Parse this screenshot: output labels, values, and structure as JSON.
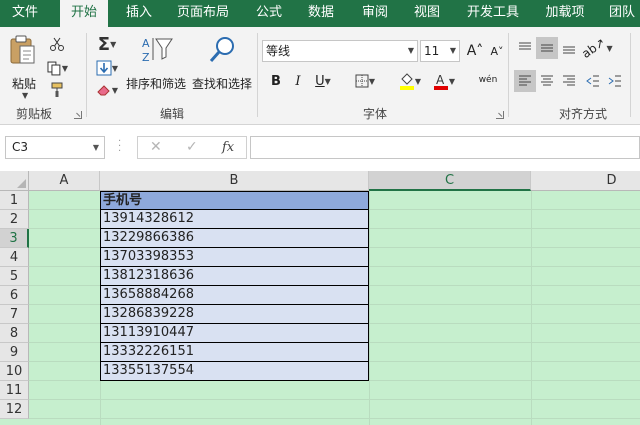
{
  "tabs": [
    "文件",
    "开始",
    "插入",
    "页面布局",
    "公式",
    "数据",
    "审阅",
    "视图",
    "开发工具",
    "加载项",
    "团队"
  ],
  "active_tab": "开始",
  "ribbon": {
    "clipboard": {
      "paste_label": "粘贴",
      "group_label": "剪贴板"
    },
    "editing": {
      "sort_filter_label": "排序和筛选",
      "find_select_label": "查找和选择",
      "group_label": "编辑"
    },
    "font": {
      "font_name": "等线",
      "font_size": "11",
      "bold": "B",
      "italic": "I",
      "underline": "U",
      "phonetic_label": "wén",
      "group_label": "字体",
      "fill_color": "#ffff00",
      "font_color": "#e00000"
    },
    "alignment": {
      "group_label": "对齐方式"
    }
  },
  "formula_bar": {
    "name_box": "C3",
    "fx_label": "fx",
    "cancel": "✕",
    "enter": "✓",
    "formula": ""
  },
  "grid": {
    "columns": [
      "A",
      "B",
      "C",
      "D"
    ],
    "selected_column": "C",
    "rows": [
      "1",
      "2",
      "3",
      "4",
      "5",
      "6",
      "7",
      "8",
      "9",
      "10",
      "11",
      "12"
    ],
    "selected_row": "3",
    "header_cell": "手机号",
    "phone_numbers": [
      "13914328612",
      "13229866386",
      "13703398353",
      "13812318636",
      "13658884268",
      "13286839228",
      "13113910447",
      "13332226151",
      "13355137554"
    ],
    "fill_color": "#c6efce",
    "header_fill": "#8ea9db",
    "data_fill": "#d9e1f2"
  }
}
